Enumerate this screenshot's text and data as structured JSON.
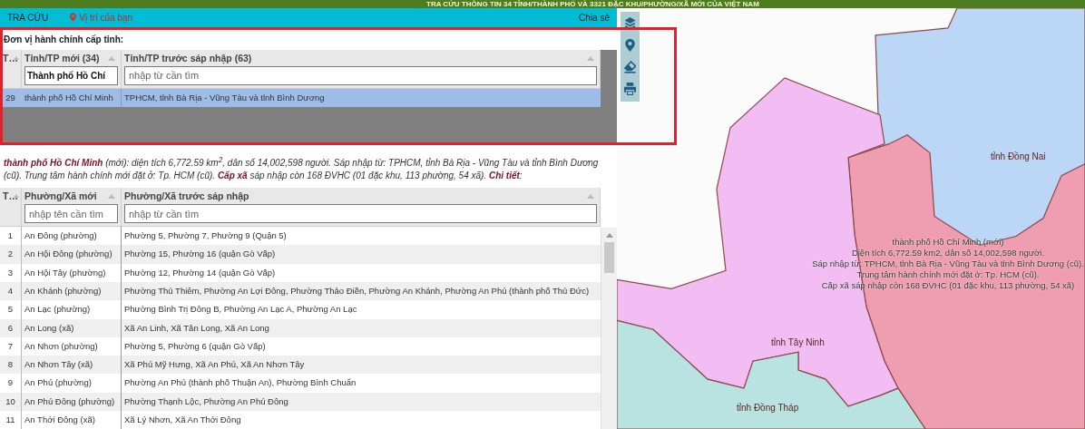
{
  "header": {
    "title": "TRA CỨU THÔNG TIN 34 TỈNH/THÀNH PHỐ VÀ 3321 ĐẶC KHU/PHƯỜNG/XÃ MỚI CỦA VIỆT NAM"
  },
  "nav": {
    "items": [
      {
        "label": "TRA CỨU",
        "kind": "text"
      },
      {
        "label": "Vị trí của bạn",
        "kind": "location"
      }
    ],
    "share": "Chia sẻ"
  },
  "province_table": {
    "title": "Đơn vị hành chính cấp tỉnh:",
    "columns": [
      {
        "label": "T…"
      },
      {
        "label": "Tỉnh/TP mới (34)",
        "filter": {
          "value": "Thành phố Hồ Chí"
        }
      },
      {
        "label": "Tỉnh/TP trước sáp nhập (63)",
        "filter": {
          "placeholder": "nhập từ cần tìm"
        }
      }
    ],
    "rows": [
      {
        "cells": [
          "29",
          "thành phố Hồ Chí Minh",
          "TPHCM, tỉnh Bà Rịa - Vũng Tàu và tỉnh Bình Dương"
        ],
        "selected": true
      }
    ]
  },
  "summary": "**thành phố Hồ Chí Minh** (mới): diện tích 6,772.59 km$^{2}$, dân số 14,002,598 người. Sáp nhập từ: TPHCM, tỉnh Bà Rịa - Vũng Tàu và tỉnh Bình Dương (cũ). Trung tâm hành chính mới đặt ở: Tp. HCM (cũ). **Cấp xã** sáp nhập còn 168 ĐVHC (01 đặc khu, 113 phường, 54 xã). **Chi tiết**:",
  "ward_table": {
    "columns": [
      {
        "label": "T…"
      },
      {
        "label": "Phường/Xã mới",
        "filter": {
          "placeholder": "nhập tên cần tìm"
        }
      },
      {
        "label": "Phường/Xã trước sáp nhập",
        "filter": {
          "placeholder": "nhập từ cần tìm"
        }
      }
    ],
    "rows": [
      {
        "cells": [
          "1",
          "An Đông (phường)",
          "Phường 5, Phường 7, Phường 9 (Quận 5)"
        ],
        "selected": false
      },
      {
        "cells": [
          "2",
          "An Hội Đông (phường)",
          "Phường 15, Phường 16 (quận Gò Vấp)"
        ],
        "selected": false
      },
      {
        "cells": [
          "3",
          "An Hội Tây (phường)",
          "Phường 12, Phường 14 (quận Gò Vấp)"
        ],
        "selected": false
      },
      {
        "cells": [
          "4",
          "An Khánh (phường)",
          "Phường Thủ Thiêm, Phường An Lợi Đông, Phường Thảo Điền, Phường An Khánh, Phường An Phú (thành phố Thủ Đức)"
        ],
        "selected": false
      },
      {
        "cells": [
          "5",
          "An Lạc (phường)",
          "Phường Bình Trị Đông B, Phường An Lạc A, Phường An Lạc"
        ],
        "selected": false
      },
      {
        "cells": [
          "6",
          "An Long (xã)",
          "Xã An Linh, Xã Tân Long, Xã An Long"
        ],
        "selected": false
      },
      {
        "cells": [
          "7",
          "An Nhơn (phường)",
          "Phường 5, Phường 6 (quận Gò Vấp)"
        ],
        "selected": false
      },
      {
        "cells": [
          "8",
          "An Nhơn Tây (xã)",
          "Xã Phú Mỹ Hưng, Xã An Phú, Xã An Nhơn Tây"
        ],
        "selected": false
      },
      {
        "cells": [
          "9",
          "An Phú (phường)",
          "Phường An Phú (thành phố Thuận An), Phường Bình Chuẩn"
        ],
        "selected": false
      },
      {
        "cells": [
          "10",
          "An Phú Đông (phường)",
          "Phường Thạnh Lộc, Phường An Phú Đông"
        ],
        "selected": false
      },
      {
        "cells": [
          "11",
          "An Thới Đông (xã)",
          "Xã Lý Nhơn, Xã An Thới Đông"
        ],
        "selected": false
      }
    ]
  },
  "map": {
    "labels": [
      {
        "text": "tỉnh Đồng Nai"
      },
      {
        "text": "tỉnh Tây Ninh"
      },
      {
        "text": "tỉnh Đồng Tháp"
      }
    ],
    "popup": {
      "lines": [
        "thành phố Hồ Chí Minh (mới)",
        "Diện tích 6,772.59 km2, dân số 14,002,598 người.",
        "Sáp nhập từ: TPHCM, tỉnh Bà Rịa - Vũng Tàu và tỉnh Bình Dương (cũ).",
        "Trung tâm hành chính mới đặt ở: Tp. HCM (cũ).",
        "Cấp xã sáp nhập còn 168 ĐVHC (01 đặc khu, 113 phường, 54 xã)"
      ]
    }
  }
}
